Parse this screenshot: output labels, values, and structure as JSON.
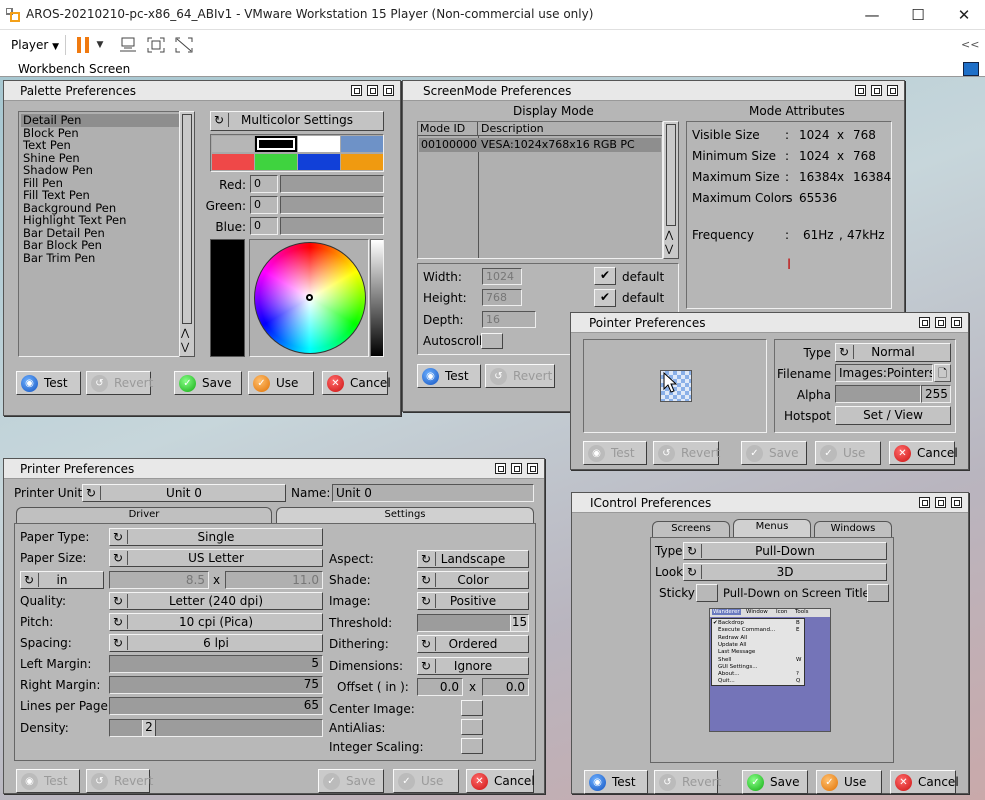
{
  "host": {
    "title": "AROS-20210210-pc-x86_64_ABIv1 - VMware Workstation 15 Player (Non-commercial use only)",
    "player_menu": "Player",
    "collapse_glyph": "<<"
  },
  "workbench": {
    "title": "Workbench Screen"
  },
  "palette": {
    "title": "Palette Preferences",
    "pens": [
      "Detail Pen",
      "Block Pen",
      "Text Pen",
      "Shine Pen",
      "Shadow Pen",
      "Fill Pen",
      "Fill Text Pen",
      "Background Pen",
      "Highlight Text Pen",
      "Bar Detail Pen",
      "Bar Block Pen",
      "Bar Trim Pen"
    ],
    "multicolor": "Multicolor Settings",
    "swatches": [
      "#000000",
      "#ffffff",
      "#6e92c7",
      "#ef4848",
      "#3fd33f",
      "#1140d8",
      "#f09a10"
    ],
    "red_label": "Red:",
    "green_label": "Green:",
    "blue_label": "Blue:",
    "red": "0",
    "green": "0",
    "blue": "0",
    "btn_test": "Test",
    "btn_revert": "Revert",
    "btn_save": "Save",
    "btn_use": "Use",
    "btn_cancel": "Cancel"
  },
  "screenmode": {
    "title": "ScreenMode Preferences",
    "display_mode": "Display Mode",
    "mode_attributes": "Mode Attributes",
    "col_modeid": "Mode ID",
    "col_desc": "Description",
    "row_id": "00100000",
    "row_desc": "VESA:1024x768x16 RGB PC",
    "attrs": [
      {
        "name": "Visible Size",
        "sep": ":",
        "a": "1024",
        "x": "x",
        "b": "768"
      },
      {
        "name": "Minimum Size",
        "sep": ":",
        "a": "1024",
        "x": "x",
        "b": "768"
      },
      {
        "name": "Maximum Size",
        "sep": ":",
        "a": "16384",
        "x": "x",
        "b": "16384"
      },
      {
        "name": "Maximum Colors",
        "sep": ":",
        "a": "65536",
        "x": "",
        "b": ""
      }
    ],
    "freq_label": "Frequency",
    "freq_sep": ":",
    "freq_h": "61Hz",
    "freq_comma": ",",
    "freq_v": "47kHz",
    "width_label": "Width:",
    "width": "1024",
    "height_label": "Height:",
    "height": "768",
    "depth_label": "Depth:",
    "depth": "16",
    "autoscroll": "Autoscroll",
    "default": "default",
    "check": "✔",
    "btn_test": "Test",
    "btn_revert": "Revert"
  },
  "pointer": {
    "title": "Pointer Preferences",
    "type_label": "Type",
    "type": "Normal",
    "filename_label": "Filename",
    "filename": "Images:Pointers/",
    "alpha_label": "Alpha",
    "alpha": "255",
    "hotspot_label": "Hotspot",
    "hotspot": "Set / View",
    "btn_test": "Test",
    "btn_revert": "Revert",
    "btn_save": "Save",
    "btn_use": "Use",
    "btn_cancel": "Cancel"
  },
  "printer": {
    "title": "Printer Preferences",
    "unit_label": "Printer Unit:",
    "unit": "Unit 0",
    "name_label": "Name:",
    "name": "Unit 0",
    "tab_driver": "Driver",
    "tab_settings": "Settings",
    "left": [
      {
        "label": "Paper Type:",
        "value": "Single"
      },
      {
        "label": "Paper Size:",
        "value": "US Letter"
      }
    ],
    "units": "in",
    "dim_w": "8.5",
    "dim_x": "x",
    "dim_h": "11.0",
    "left2": [
      {
        "label": "Quality:",
        "value": "Letter (240 dpi)"
      },
      {
        "label": "Pitch:",
        "value": "10 cpi (Pica)"
      },
      {
        "label": "Spacing:",
        "value": "6 lpi"
      }
    ],
    "margins": [
      {
        "label": "Left Margin:",
        "value": "5"
      },
      {
        "label": "Right Margin:",
        "value": "75"
      },
      {
        "label": "Lines per Page:",
        "value": "65"
      }
    ],
    "density_label": "Density:",
    "density": "2",
    "right": [
      {
        "label": "Aspect:",
        "value": "Landscape"
      },
      {
        "label": "Shade:",
        "value": "Color"
      },
      {
        "label": "Image:",
        "value": "Positive"
      }
    ],
    "threshold_label": "Threshold:",
    "threshold": "15",
    "dithering_label": "Dithering:",
    "dithering": "Ordered",
    "dimensions_label": "Dimensions:",
    "dimensions": "Ignore",
    "offset_label": "Offset ( in ):",
    "off_x": "0.0",
    "off_sep": "x",
    "off_y": "0.0",
    "center_label": "Center Image:",
    "antialias_label": "AntiAlias:",
    "intscale_label": "Integer Scaling:",
    "btn_test": "Test",
    "btn_revert": "Revert",
    "btn_save": "Save",
    "btn_use": "Use",
    "btn_cancel": "Cancel"
  },
  "icontrol": {
    "title": "IControl Preferences",
    "tab_screens": "Screens",
    "tab_menus": "Menus",
    "tab_windows": "Windows",
    "type_label": "Type",
    "type": "Pull-Down",
    "look_label": "Look",
    "look": "3D",
    "sticky_label": "Sticky",
    "pulldown_title": "Pull-Down on Screen Title",
    "menu_bar": [
      "Wanderer",
      "Window",
      "Icon",
      "Tools"
    ],
    "menu_items": [
      {
        "label": "Backdrop",
        "key": "B",
        "check": "✔"
      },
      {
        "label": "Execute Command...",
        "key": "E",
        "check": ""
      },
      {
        "label": "Redraw All",
        "key": "",
        "check": ""
      },
      {
        "label": "Update All",
        "key": "",
        "check": ""
      },
      {
        "label": "Last Message",
        "key": "",
        "check": ""
      },
      {
        "label": "Shell",
        "key": "W",
        "check": ""
      },
      {
        "label": "GUI Settings...",
        "key": "",
        "check": ""
      },
      {
        "label": "About...",
        "key": "?",
        "check": ""
      },
      {
        "label": "Quit...",
        "key": "Q",
        "check": ""
      }
    ],
    "btn_test": "Test",
    "btn_revert": "Revert",
    "btn_save": "Save",
    "btn_use": "Use",
    "btn_cancel": "Cancel"
  }
}
